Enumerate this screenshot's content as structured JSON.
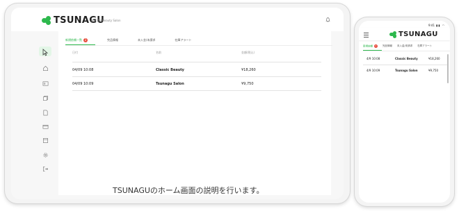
{
  "brand": {
    "name": "TSUNAGU",
    "color": "#2db84d"
  },
  "tablet": {
    "company_name": "株式会社Beauty Salon",
    "sidebar_icons": [
      "cursor-icon",
      "home-icon",
      "id-card-icon",
      "stack-icon",
      "document-icon",
      "card-icon",
      "calendar-icon",
      "gear-icon",
      "logout-icon"
    ],
    "tabs": [
      {
        "label": "新規依頼一覧",
        "badge": "2",
        "active": true
      },
      {
        "label": "完品情報",
        "active": false
      },
      {
        "label": "未入金/未請求",
        "active": false
      },
      {
        "label": "在庫アラート",
        "active": false
      }
    ],
    "table": {
      "headers": [
        "日付",
        "名前",
        "金額(税込)"
      ],
      "rows": [
        {
          "date": "04/09 10:08",
          "name": "Classic Beauty",
          "amount": "¥18,260"
        },
        {
          "date": "04/09 10:09",
          "name": "Tsunagu Salon",
          "amount": "¥9,750"
        }
      ]
    },
    "caption": "TSUNAGUのホーム画面の説明を行います。"
  },
  "phone": {
    "status": {
      "time": "9:41",
      "icons": "▮▮ ◠ ▭"
    },
    "tabs": [
      {
        "label": "新規依頼",
        "badge": "2",
        "active": true
      },
      {
        "label": "完品情報",
        "active": false
      },
      {
        "label": "未入金/未請求",
        "active": false
      },
      {
        "label": "在庫アラート",
        "active": false
      }
    ],
    "table": {
      "rows": [
        {
          "date": "4/9 10:08",
          "name": "Classic Beauty",
          "amount": "¥18,260"
        },
        {
          "date": "4/9 10:09",
          "name": "Tsunagu Salon",
          "amount": "¥9,750"
        }
      ]
    }
  }
}
